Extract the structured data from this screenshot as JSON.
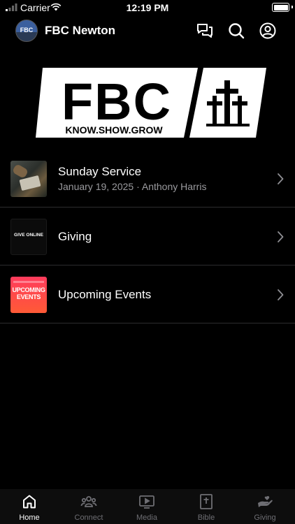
{
  "status_bar": {
    "carrier": "Carrier",
    "time": "12:19 PM"
  },
  "header": {
    "avatar_text": "FBC",
    "title": "FBC Newton",
    "icons": [
      "chat-icon",
      "search-icon",
      "profile-icon"
    ]
  },
  "banner": {
    "logo_text": "FBC",
    "tagline": "KNOW.SHOW.GROW",
    "icon": "three-crosses-icon"
  },
  "list": [
    {
      "title": "Sunday Service",
      "subtitle": "January 19, 2025 · Anthony Harris"
    },
    {
      "title": "Giving",
      "thumb_text": "GIVE ONLINE"
    },
    {
      "title": "Upcoming Events",
      "thumb_text": "UPCOMING EVENTS"
    }
  ],
  "tabs": [
    {
      "label": "Home",
      "icon": "home-icon",
      "active": true
    },
    {
      "label": "Connect",
      "icon": "people-icon",
      "active": false
    },
    {
      "label": "Media",
      "icon": "play-icon",
      "active": false
    },
    {
      "label": "Bible",
      "icon": "bible-icon",
      "active": false
    },
    {
      "label": "Giving",
      "icon": "hand-giving-icon",
      "active": false
    }
  ],
  "colors": {
    "background": "#000000",
    "subtitle": "#9a9a9e",
    "tab_inactive": "#6e6e73",
    "divider": "#2c2c2e"
  }
}
